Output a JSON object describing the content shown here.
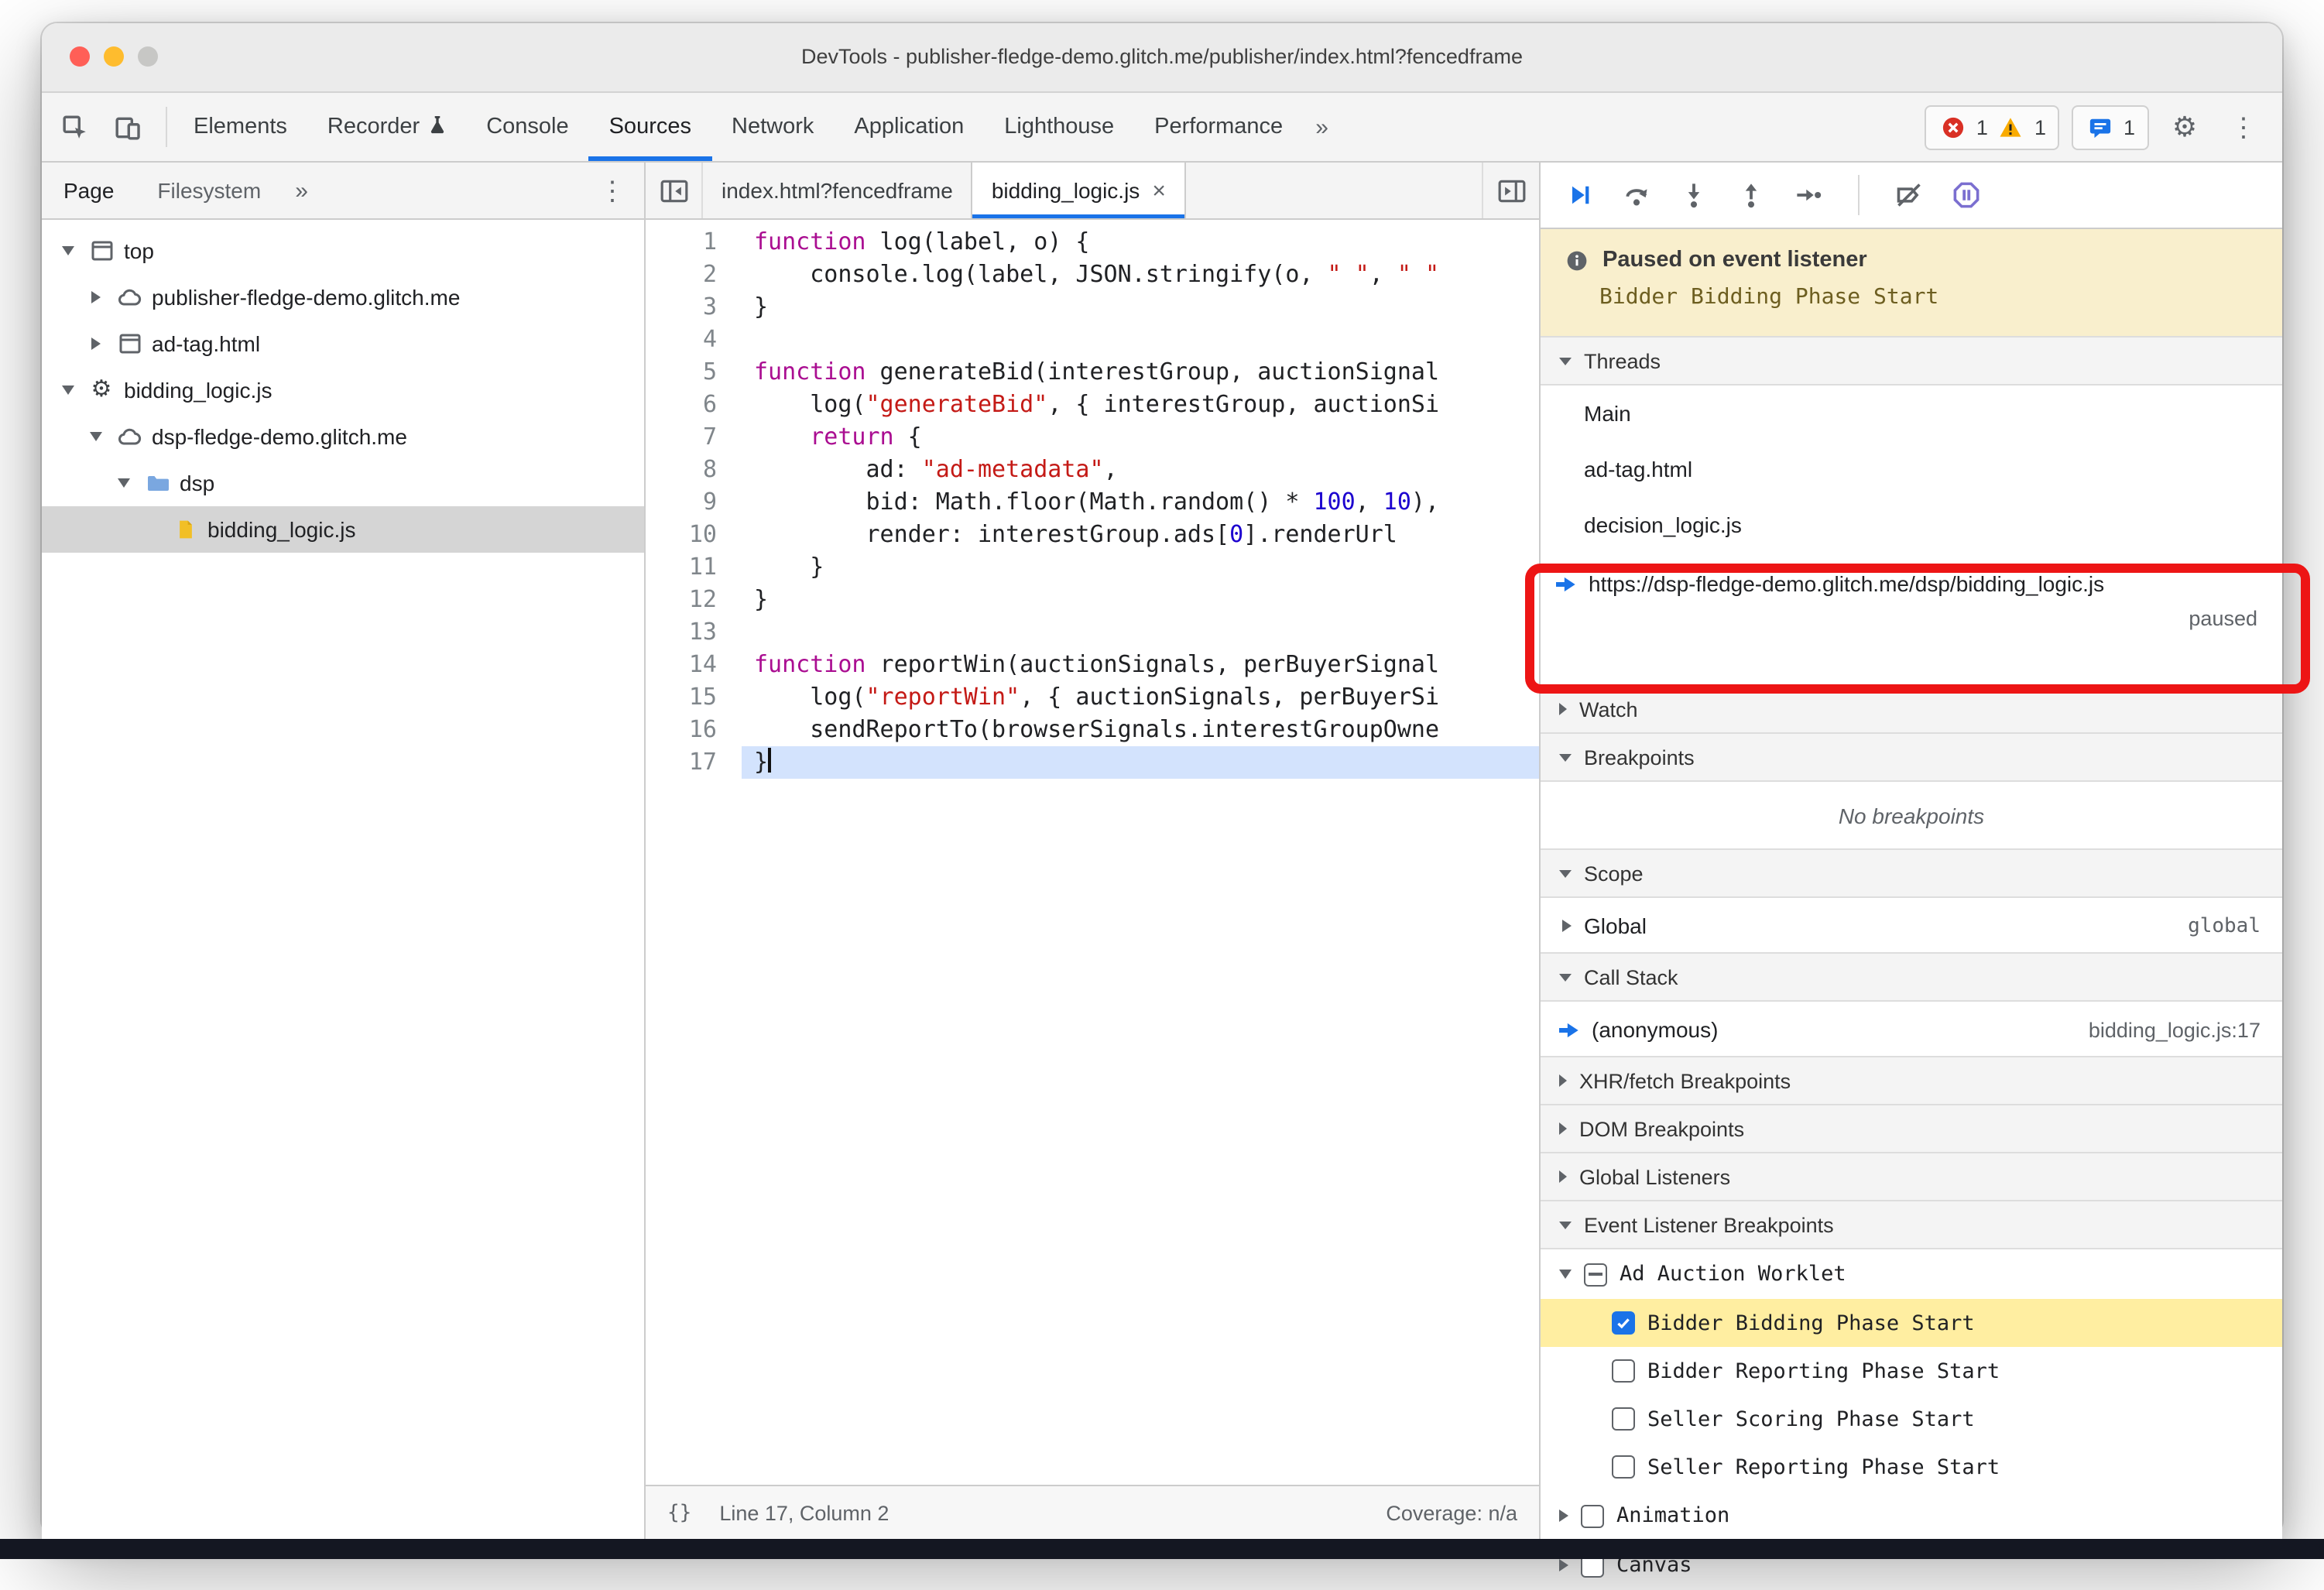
{
  "colors": {
    "accent_blue": "#1a73e8",
    "annotation_red": "#ed1515",
    "paused_banner_bg": "#f9efcd",
    "breakpoint_hit_bg": "#ffeea1",
    "error_red": "#d93025",
    "warning_yellow": "#f9ab00",
    "selection_gray": "#d5d5d5",
    "current_line_blue": "#d3e3fd"
  },
  "window": {
    "title": "DevTools - publisher-fledge-demo.glitch.me/publisher/index.html?fencedframe"
  },
  "toolbar": {
    "tabs": [
      {
        "label": "Elements"
      },
      {
        "label": "Recorder",
        "icon": "flask"
      },
      {
        "label": "Console"
      },
      {
        "label": "Sources",
        "active": true
      },
      {
        "label": "Network"
      },
      {
        "label": "Application"
      },
      {
        "label": "Lighthouse"
      },
      {
        "label": "Performance"
      }
    ],
    "more": "»",
    "error_count": "1",
    "warning_count": "1",
    "issues_count": "1"
  },
  "navigator": {
    "tabs": [
      "Page",
      "Filesystem"
    ],
    "more": "»",
    "tree": [
      {
        "label": "top",
        "icon": "frame",
        "arrow": "expanded",
        "depth": 0
      },
      {
        "label": "publisher-fledge-demo.glitch.me",
        "icon": "cloud",
        "arrow": "collapsed",
        "depth": 1
      },
      {
        "label": "ad-tag.html",
        "icon": "frame",
        "arrow": "collapsed",
        "depth": 1
      },
      {
        "label": "bidding_logic.js",
        "icon": "worklet",
        "arrow": "expanded",
        "depth": 0
      },
      {
        "label": "dsp-fledge-demo.glitch.me",
        "icon": "cloud",
        "arrow": "expanded",
        "depth": 1
      },
      {
        "label": "dsp",
        "icon": "folder",
        "arrow": "expanded",
        "depth": 2
      },
      {
        "label": "bidding_logic.js",
        "icon": "file-js",
        "arrow": "none",
        "depth": 3,
        "selected": true
      }
    ]
  },
  "editor": {
    "tabs": [
      {
        "label": "index.html?fencedframe"
      },
      {
        "label": "bidding_logic.js",
        "active": true,
        "close": "×"
      }
    ],
    "current_line": 17,
    "lines": [
      [
        {
          "t": "kw",
          "v": "function"
        },
        {
          "t": "pl",
          "v": " log(label, o) {"
        }
      ],
      [
        {
          "t": "pl",
          "v": "    console.log(label, JSON.stringify(o, "
        },
        {
          "t": "str",
          "v": "\" \""
        },
        {
          "t": "pl",
          "v": ", "
        },
        {
          "t": "str",
          "v": "\" \""
        }
      ],
      [
        {
          "t": "pl",
          "v": "}"
        }
      ],
      [],
      [
        {
          "t": "kw",
          "v": "function"
        },
        {
          "t": "pl",
          "v": " generateBid(interestGroup, auctionSignal"
        }
      ],
      [
        {
          "t": "pl",
          "v": "    log("
        },
        {
          "t": "str",
          "v": "\"generateBid\""
        },
        {
          "t": "pl",
          "v": ", { interestGroup, auctionSi"
        }
      ],
      [
        {
          "t": "pl",
          "v": "    "
        },
        {
          "t": "kw",
          "v": "return"
        },
        {
          "t": "pl",
          "v": " {"
        }
      ],
      [
        {
          "t": "pl",
          "v": "        ad: "
        },
        {
          "t": "str",
          "v": "\"ad-metadata\""
        },
        {
          "t": "pl",
          "v": ","
        }
      ],
      [
        {
          "t": "pl",
          "v": "        bid: Math.floor(Math.random() * "
        },
        {
          "t": "num",
          "v": "100"
        },
        {
          "t": "pl",
          "v": ", "
        },
        {
          "t": "num",
          "v": "10"
        },
        {
          "t": "pl",
          "v": "),"
        }
      ],
      [
        {
          "t": "pl",
          "v": "        render: interestGroup.ads["
        },
        {
          "t": "num",
          "v": "0"
        },
        {
          "t": "pl",
          "v": "].renderUrl"
        }
      ],
      [
        {
          "t": "pl",
          "v": "    }"
        }
      ],
      [
        {
          "t": "pl",
          "v": "}"
        }
      ],
      [],
      [
        {
          "t": "kw",
          "v": "function"
        },
        {
          "t": "pl",
          "v": " reportWin(auctionSignals, perBuyerSignal"
        }
      ],
      [
        {
          "t": "pl",
          "v": "    log("
        },
        {
          "t": "str",
          "v": "\"reportWin\""
        },
        {
          "t": "pl",
          "v": ", { auctionSignals, perBuyerSi"
        }
      ],
      [
        {
          "t": "pl",
          "v": "    sendReportTo(browserSignals.interestGroupOwne"
        }
      ],
      [
        {
          "t": "pl",
          "v": "}"
        }
      ]
    ],
    "status": {
      "braces": "{}",
      "position": "Line 17, Column 2",
      "coverage": "Coverage: n/a"
    }
  },
  "debugger": {
    "banner": {
      "title": "Paused on event listener",
      "subtitle": "Bidder Bidding Phase Start"
    },
    "threads": {
      "header": "Threads",
      "items": [
        {
          "label": "Main"
        },
        {
          "label": "ad-tag.html"
        },
        {
          "label": "decision_logic.js"
        },
        {
          "label": "https://dsp-fledge-demo.glitch.me/dsp/bidding_logic.js",
          "active": true,
          "status": "paused"
        }
      ]
    },
    "watch": {
      "header": "Watch"
    },
    "breakpoints": {
      "header": "Breakpoints",
      "empty": "No breakpoints"
    },
    "scope": {
      "header": "Scope",
      "rows": [
        {
          "label": "Global",
          "annotation": "global"
        }
      ]
    },
    "call_stack": {
      "header": "Call Stack",
      "frames": [
        {
          "name": "(anonymous)",
          "location": "bidding_logic.js:17",
          "active": true
        }
      ]
    },
    "collapsed_sections": [
      "XHR/fetch Breakpoints",
      "DOM Breakpoints",
      "Global Listeners"
    ],
    "event_listener_breakpoints": {
      "header": "Event Listener Breakpoints",
      "categories": [
        {
          "label": "Ad Auction Worklet",
          "checkbox": "indeterminate",
          "arrow": "expanded",
          "children": [
            {
              "label": "Bidder Bidding Phase Start",
              "checked": true,
              "highlighted": true
            },
            {
              "label": "Bidder Reporting Phase Start",
              "checked": false
            },
            {
              "label": "Seller Scoring Phase Start",
              "checked": false
            },
            {
              "label": "Seller Reporting Phase Start",
              "checked": false
            }
          ]
        },
        {
          "label": "Animation",
          "checkbox": "unchecked",
          "arrow": "collapsed",
          "children": []
        },
        {
          "label": "Canvas",
          "checkbox": "unchecked",
          "arrow": "collapsed",
          "children": []
        }
      ]
    }
  }
}
